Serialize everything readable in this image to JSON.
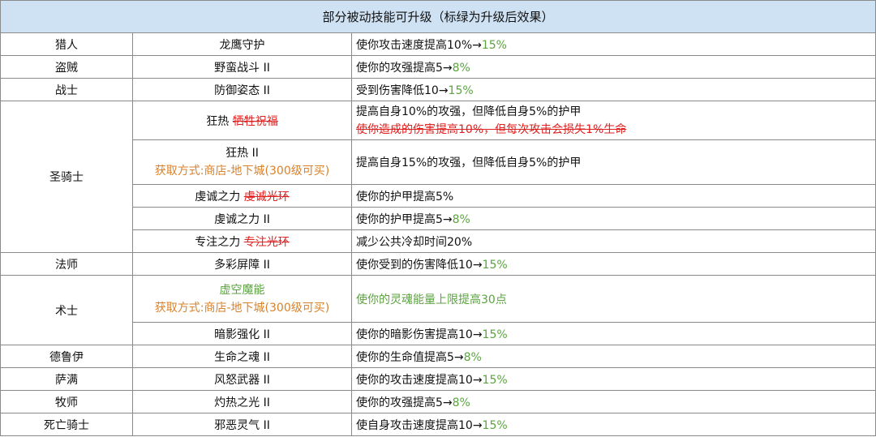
{
  "title": "部分被动技能可升级（标绿为升级后效果）",
  "acquire": "获取方式:商店-地下城(300级可买)",
  "rows": {
    "hunter": {
      "cls": "猎人",
      "skill": "龙鹰守护",
      "eff": "使你攻击速度提高10%→",
      "up": "15%"
    },
    "rogue": {
      "cls": "盗贼",
      "skill": "野蛮战斗 II",
      "eff": "使你的攻强提高5→",
      "up": "8%"
    },
    "warrior": {
      "cls": "战士",
      "skill": "防御姿态 II",
      "eff": "受到伤害降低10→",
      "up": "15%"
    },
    "paladin": {
      "cls": "圣骑士",
      "r1": {
        "skill": "狂热",
        "old": "牺牲祝福",
        "eff": "提高自身10%的攻强，但降低自身5%的护甲",
        "old_eff": "使你造成的伤害提高10%，但每次攻击会损失1%生命"
      },
      "r2": {
        "skill": "狂热 II",
        "eff": "提高自身15%的攻强，但降低自身5%的护甲"
      },
      "r3": {
        "skill": "虔诚之力",
        "old": "虔诚光环",
        "eff": "使你的护甲提高5%"
      },
      "r4": {
        "skill": "虔诚之力 II",
        "eff": "使你的护甲提高5→",
        "up": "8%"
      },
      "r5": {
        "skill": "专注之力",
        "old": "专注光环",
        "eff": "减少公共冷却时间20%"
      }
    },
    "mage": {
      "cls": "法师",
      "skill": "多彩屏障 II",
      "eff": "使你受到的伤害降低10→",
      "up": "15%"
    },
    "warlock": {
      "cls": "术士",
      "r1": {
        "skill": "虚空魔能",
        "eff": "使你的灵魂能量上限提高30点"
      },
      "r2": {
        "skill": "暗影强化 II",
        "eff": "使你的暗影伤害提高10→",
        "up": "15%"
      }
    },
    "druid": {
      "cls": "德鲁伊",
      "skill": "生命之魂 II",
      "eff": "使你的生命值提高5→",
      "up": "8%"
    },
    "shaman": {
      "cls": "萨满",
      "skill": "风怒武器 II",
      "eff": "使你的攻击速度提高10→",
      "up": "15%"
    },
    "priest": {
      "cls": "牧师",
      "skill": "灼热之光 II",
      "eff": "使你的攻强提高5→",
      "up": "8%"
    },
    "dk": {
      "cls": "死亡骑士",
      "skill": "邪恶灵气 II",
      "eff": "使自身攻击速度提高10→",
      "up": "15%"
    }
  }
}
